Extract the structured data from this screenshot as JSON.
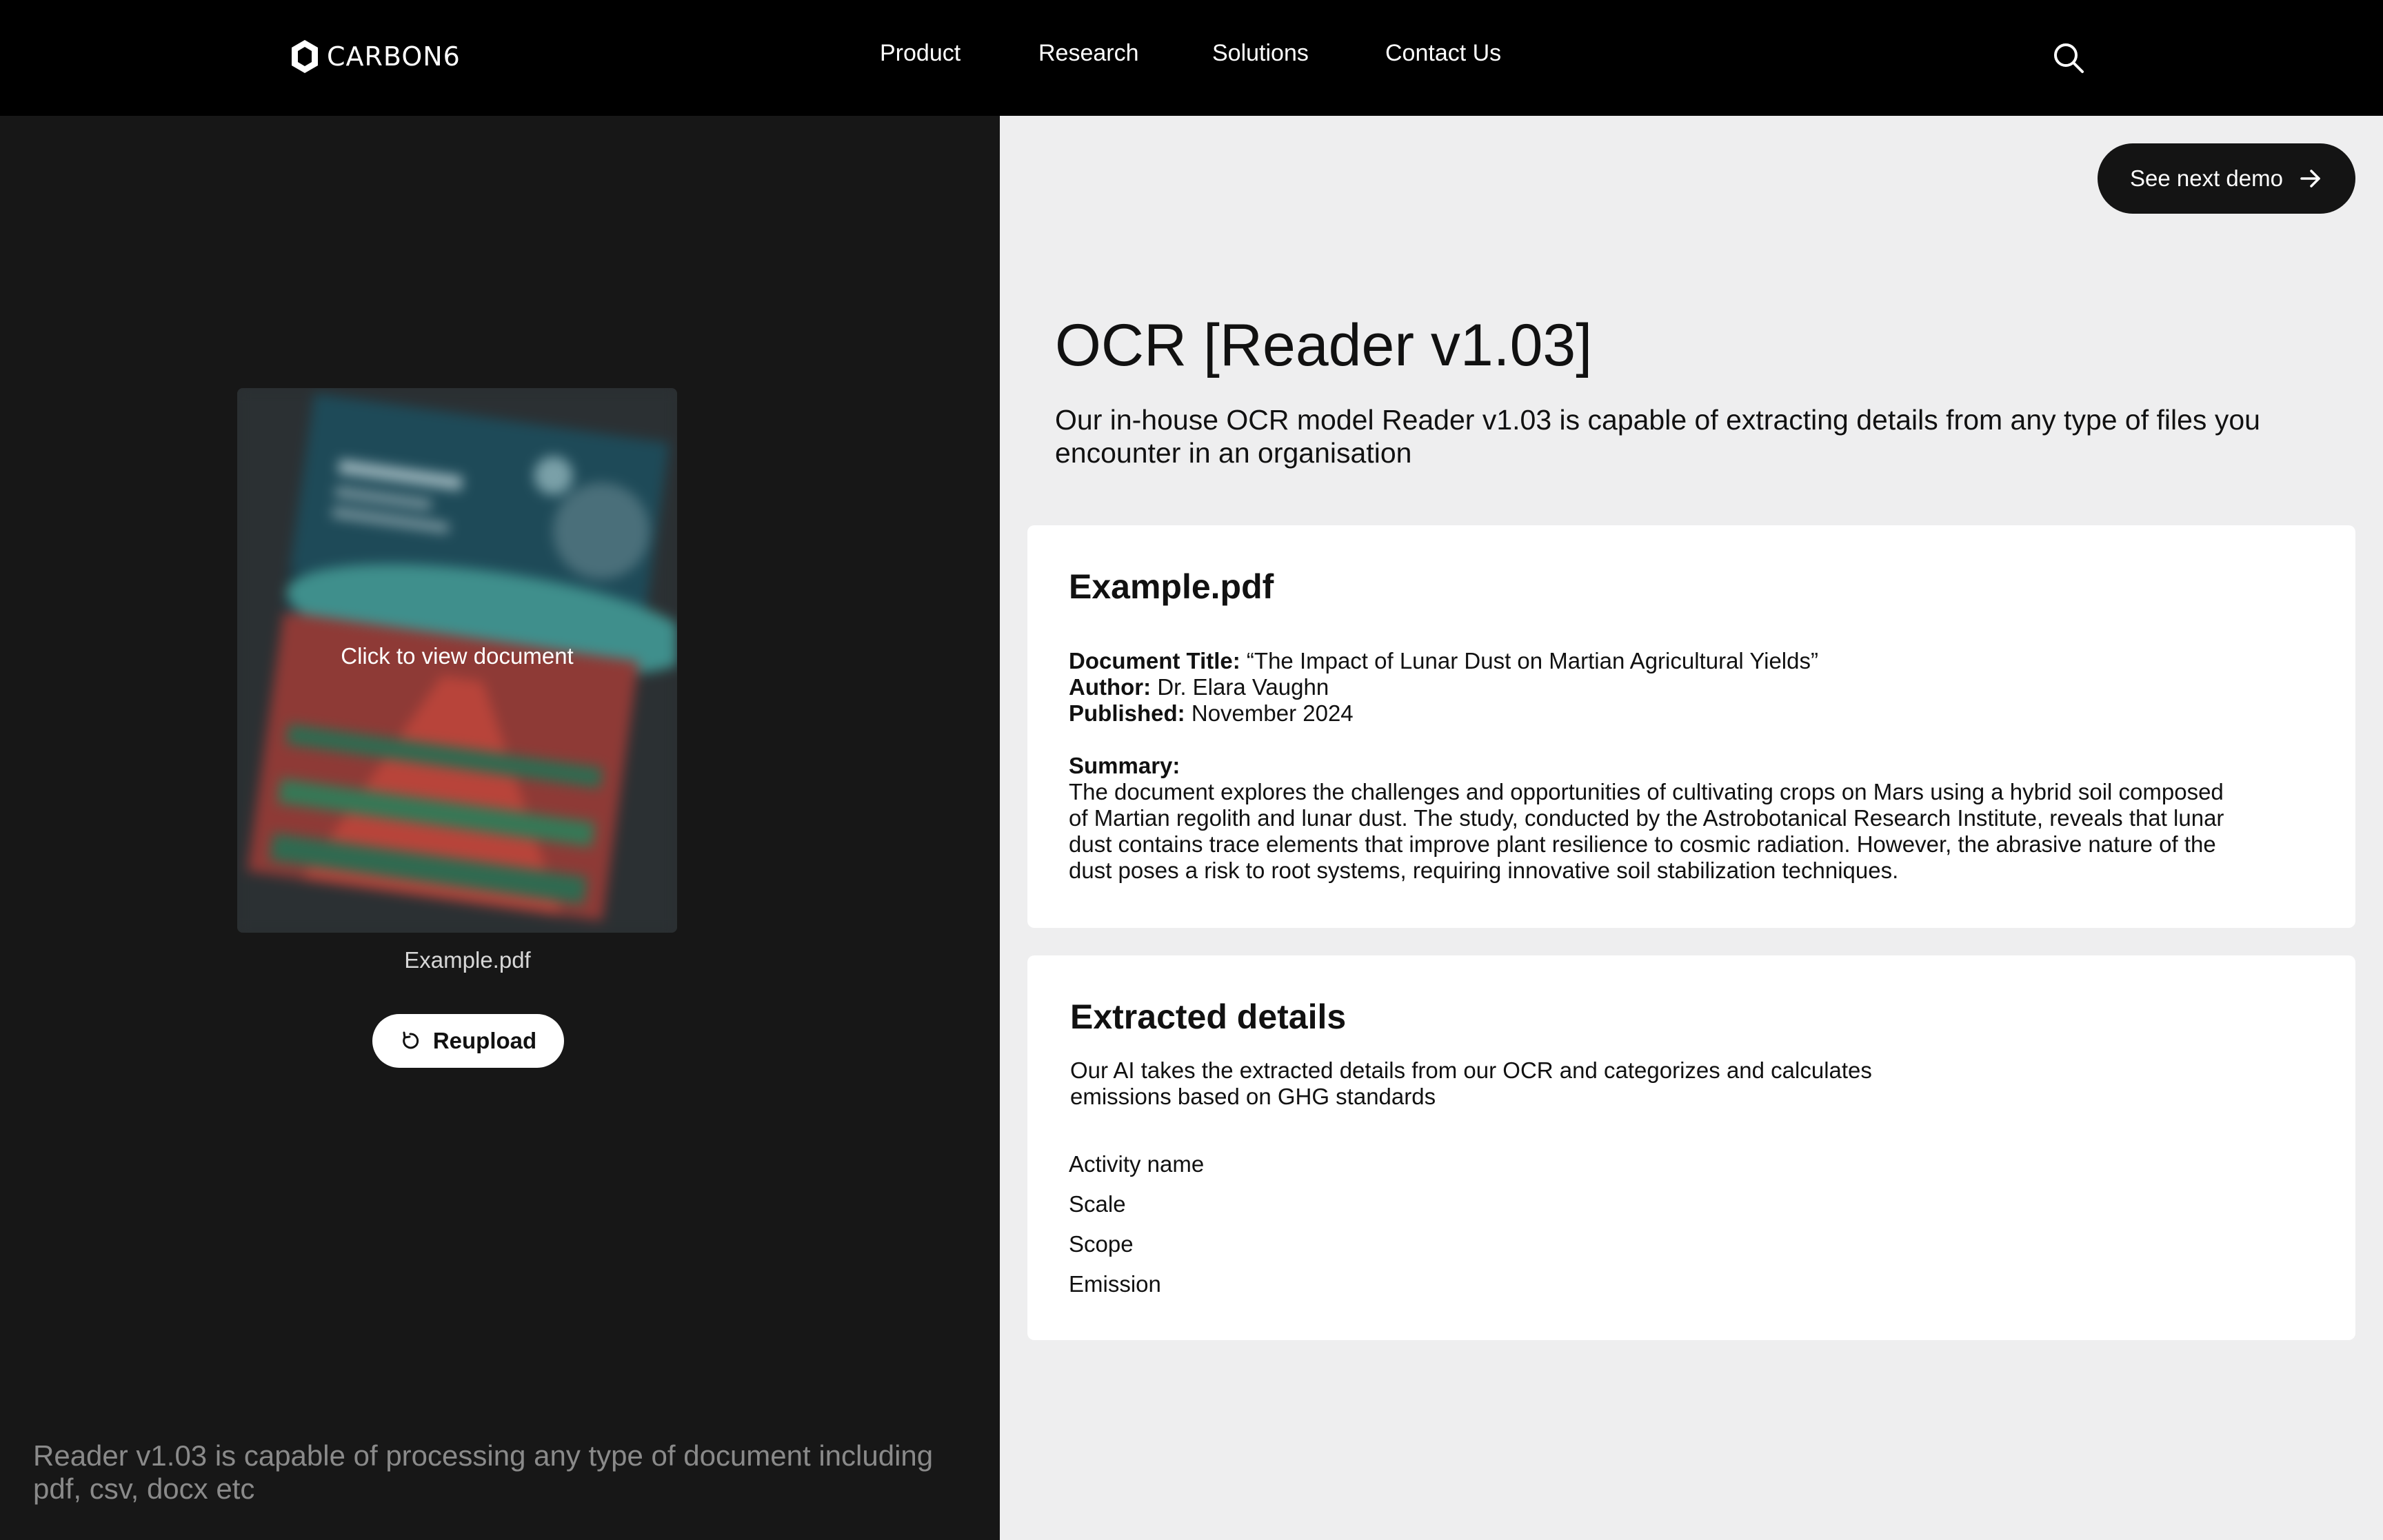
{
  "header": {
    "logo_text": "CARBON6",
    "nav": [
      "Product",
      "Research",
      "Solutions",
      "Contact Us"
    ],
    "search_icon": "search-icon"
  },
  "left": {
    "preview_cta": "Click to view document",
    "file_name": "Example.pdf",
    "reupload_label": "Reupload",
    "reupload_icon": "refresh-icon",
    "footnote": "Reader v1.03 is capable of processing any type of document including pdf, csv, docx etc"
  },
  "right": {
    "next_demo_label": "See next demo",
    "next_demo_icon": "arrow-right-icon",
    "title": "OCR [Reader v1.03]",
    "subtitle": "Our in-house OCR model Reader v1.03 is capable of extracting details from any type of files you encounter in an organisation",
    "summary_card": {
      "title": "Example.pdf",
      "document_title_label": "Document Title:",
      "document_title_value": "“The Impact of Lunar Dust on Martian Agricultural Yields”",
      "author_label": "Author:",
      "author_value": "Dr. Elara Vaughn",
      "published_label": "Published:",
      "published_value": "November 2024",
      "summary_label": "Summary:",
      "summary_text": "The document explores the challenges and opportunities of cultivating crops on Mars using a hybrid soil composed of Martian regolith and lunar dust. The study, conducted by the Astrobotanical Research Institute, reveals that lunar dust contains trace elements that improve plant resilience to cosmic radiation. However, the abrasive nature of the dust poses a risk to root systems, requiring innovative soil stabilization techniques."
    },
    "extracted_card": {
      "title": "Extracted details",
      "description": "Our AI takes the extracted details from our OCR and categorizes and calculates emissions based on GHG standards",
      "fields": [
        "Activity name",
        "Scale",
        "Scope",
        "Emission"
      ]
    }
  },
  "colors": {
    "header_bg": "#000000",
    "left_panel_bg": "#171717",
    "right_panel_bg": "#eeeeef",
    "card_bg": "#ffffff",
    "dark_button_bg": "#141414"
  }
}
